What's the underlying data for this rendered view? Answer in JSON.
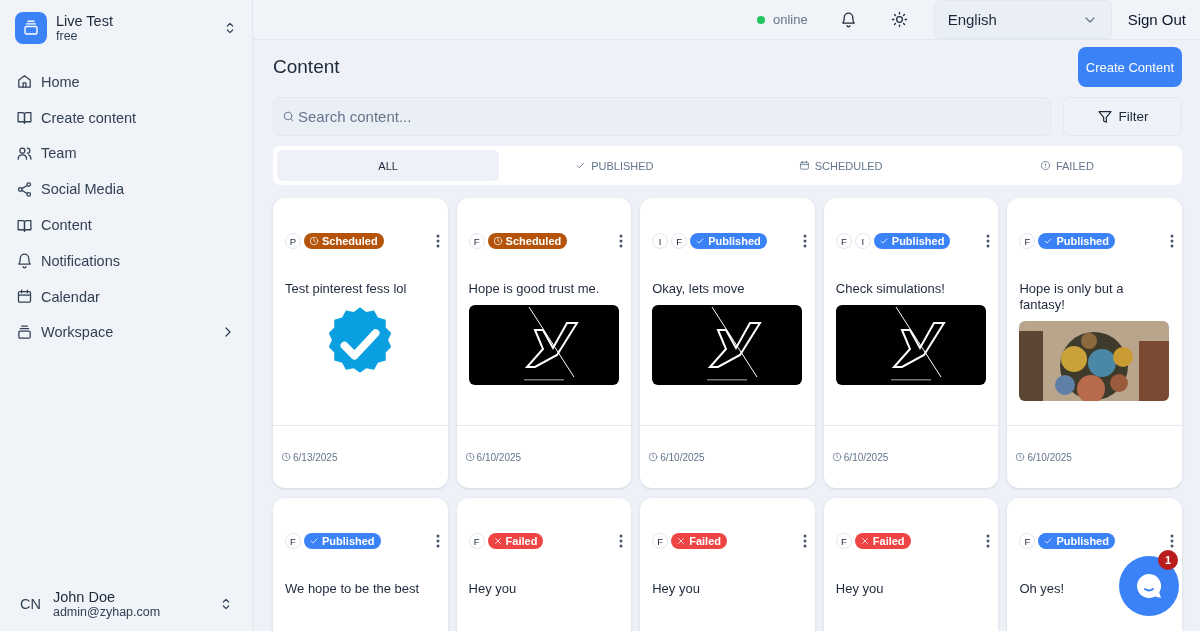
{
  "workspace": {
    "name": "Live Test",
    "plan": "free"
  },
  "nav": [
    {
      "label": "Home",
      "expandable": false
    },
    {
      "label": "Create content",
      "expandable": false
    },
    {
      "label": "Team",
      "expandable": false
    },
    {
      "label": "Social Media",
      "expandable": false
    },
    {
      "label": "Content",
      "expandable": false
    },
    {
      "label": "Notifications",
      "expandable": false
    },
    {
      "label": "Calendar",
      "expandable": false
    },
    {
      "label": "Workspace",
      "expandable": true
    }
  ],
  "user": {
    "initials": "CN",
    "name": "John Doe",
    "email": "admin@zyhap.com"
  },
  "header": {
    "status": "online",
    "language": "English",
    "sign_out": "Sign Out"
  },
  "page": {
    "title": "Content",
    "create_button": "Create Content",
    "search": {
      "placeholder": "Search content..."
    },
    "filter": "Filter"
  },
  "tabs": [
    {
      "label": "ALL",
      "selected": true
    },
    {
      "label": "PUBLISHED",
      "selected": false
    },
    {
      "label": "SCHEDULED",
      "selected": false
    },
    {
      "label": "FAILED",
      "selected": false
    }
  ],
  "cards": [
    {
      "platforms": [
        "P"
      ],
      "status": {
        "label": "Scheduled",
        "kind": "scheduled"
      },
      "text": "Test pinterest fess lol",
      "media": {
        "kind": "icon"
      },
      "date": "6/13/2025"
    },
    {
      "platforms": [
        "F"
      ],
      "status": {
        "label": "Scheduled",
        "kind": "scheduled"
      },
      "text": "Hope is good trust me.",
      "media": {
        "kind": "logo"
      },
      "date": "6/10/2025"
    },
    {
      "platforms": [
        "I",
        "F"
      ],
      "status": {
        "label": "Published",
        "kind": "published"
      },
      "text": "Okay, lets move",
      "media": {
        "kind": "logo"
      },
      "date": "6/10/2025"
    },
    {
      "platforms": [
        "F",
        "I"
      ],
      "status": {
        "label": "Published",
        "kind": "published"
      },
      "text": "Check simulations!",
      "media": {
        "kind": "logo"
      },
      "date": "6/10/2025"
    },
    {
      "platforms": [
        "F"
      ],
      "status": {
        "label": "Published",
        "kind": "published"
      },
      "text": "Hope is only but a fantasy!",
      "media": {
        "kind": "art"
      },
      "date": "6/10/2025"
    },
    {
      "platforms": [
        "F"
      ],
      "status": {
        "label": "Published",
        "kind": "published"
      },
      "text": "We hope to be the best"
    },
    {
      "platforms": [
        "F"
      ],
      "status": {
        "label": "Failed",
        "kind": "failed"
      },
      "text": "Hey you"
    },
    {
      "platforms": [
        "F"
      ],
      "status": {
        "label": "Failed",
        "kind": "failed"
      },
      "text": "Hey you"
    },
    {
      "platforms": [
        "F"
      ],
      "status": {
        "label": "Failed",
        "kind": "failed"
      },
      "text": "Hey you"
    },
    {
      "platforms": [
        "F"
      ],
      "status": {
        "label": "Published",
        "kind": "published"
      },
      "text": "Oh yes!"
    }
  ],
  "chat": {
    "count": "1"
  }
}
